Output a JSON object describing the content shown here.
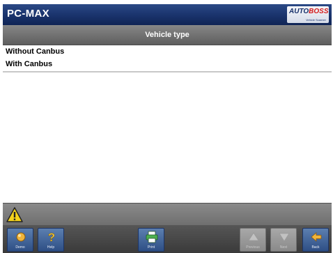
{
  "app": {
    "title": "PC-MAX",
    "brand_prefix": "AUTO",
    "brand_suffix": "BOSS",
    "brand_tagline": "Vehicle Scanner"
  },
  "header": {
    "title": "Vehicle type"
  },
  "list": {
    "items": [
      {
        "label": "Without Canbus"
      },
      {
        "label": "With Canbus"
      }
    ]
  },
  "status": {
    "icon": "warning-icon",
    "color": "#f4d21c"
  },
  "toolbar": {
    "buttons": [
      {
        "label": "Demo",
        "icon": "demo-icon",
        "enabled": true
      },
      {
        "label": "Help",
        "icon": "help-icon",
        "enabled": true
      },
      {
        "label": "Print",
        "icon": "print-icon",
        "enabled": true
      },
      {
        "label": "Previous",
        "icon": "previous-icon",
        "enabled": false
      },
      {
        "label": "Next",
        "icon": "next-icon",
        "enabled": false
      },
      {
        "label": "Back",
        "icon": "back-icon",
        "enabled": true
      }
    ]
  },
  "colors": {
    "title_bar": "#1c3670",
    "header_bar": "#6f6f6f",
    "toolbar_button": "#3d5f95",
    "brand_accent": "#d51b1b"
  }
}
